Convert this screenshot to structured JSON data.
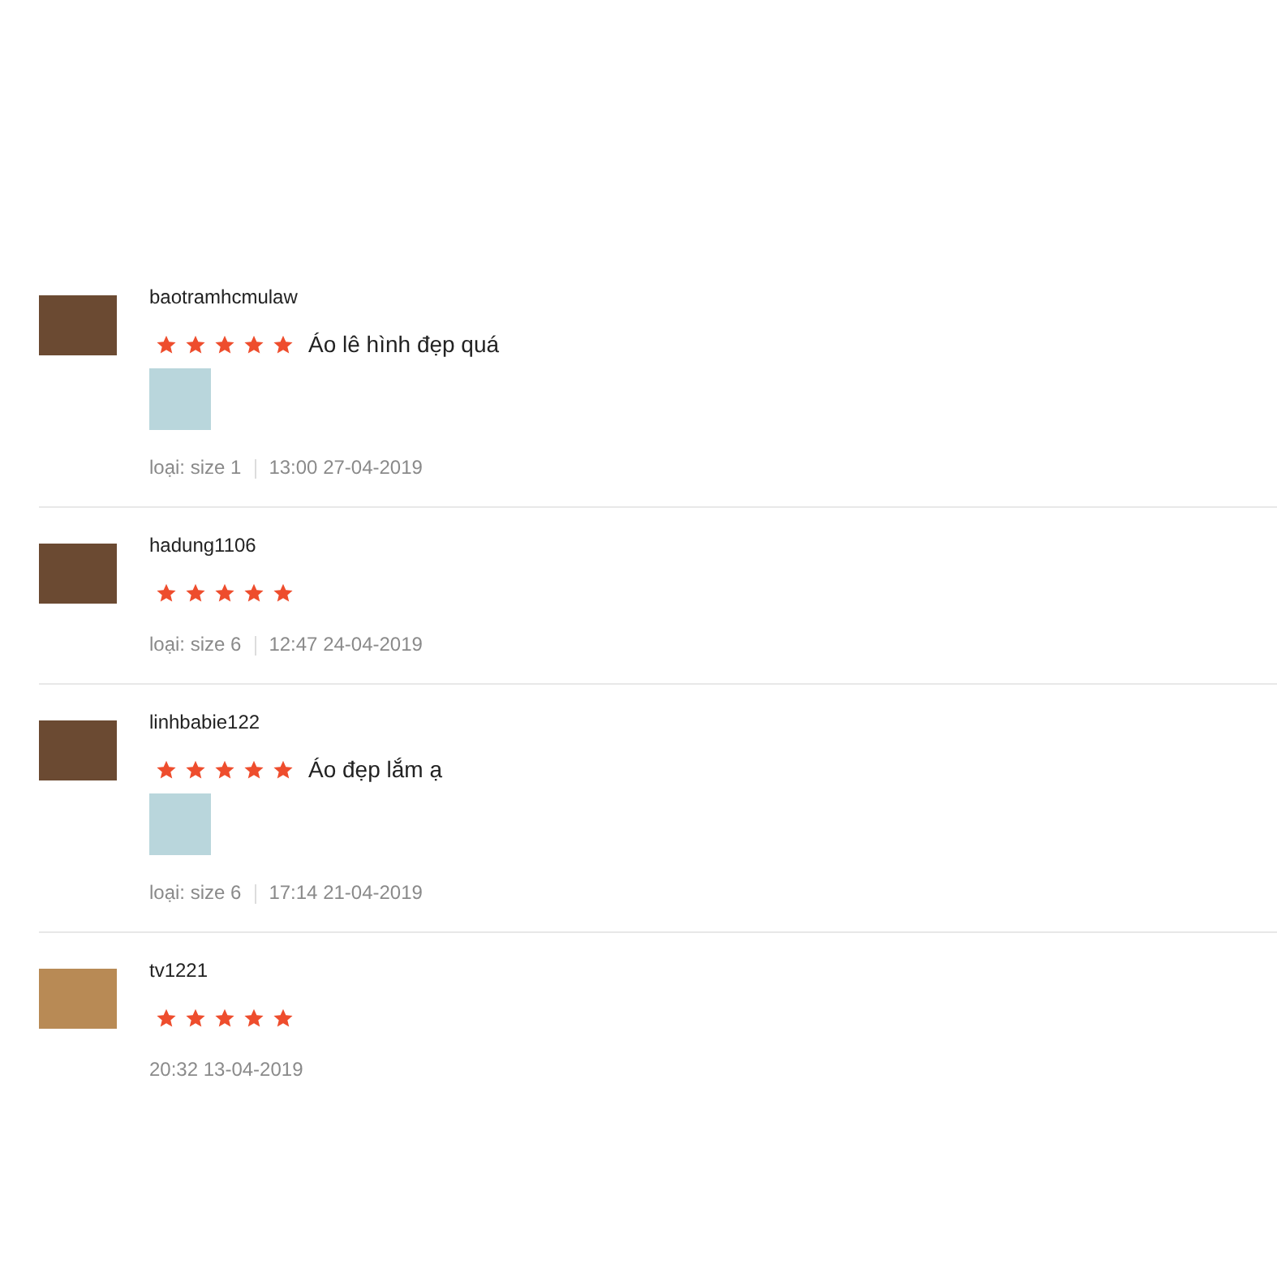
{
  "reviews": [
    {
      "username": "baotramhcmulaw",
      "stars": 5,
      "comment": "Áo lê hình đẹp quá",
      "photo": true,
      "variant": "loại: size 1",
      "time": "13:00 27-04-2019"
    },
    {
      "username": "hadung1106",
      "stars": 5,
      "variant": "loại: size 6",
      "time": "12:47 24-04-2019"
    },
    {
      "username": "linhbabie122",
      "stars": 5,
      "comment": "Áo đẹp lắm ạ",
      "photo": true,
      "variant": "loại: size 6",
      "time": "17:14 21-04-2019"
    },
    {
      "username": "tv1221",
      "stars": 5,
      "time": "20:32 13-04-2019"
    }
  ]
}
